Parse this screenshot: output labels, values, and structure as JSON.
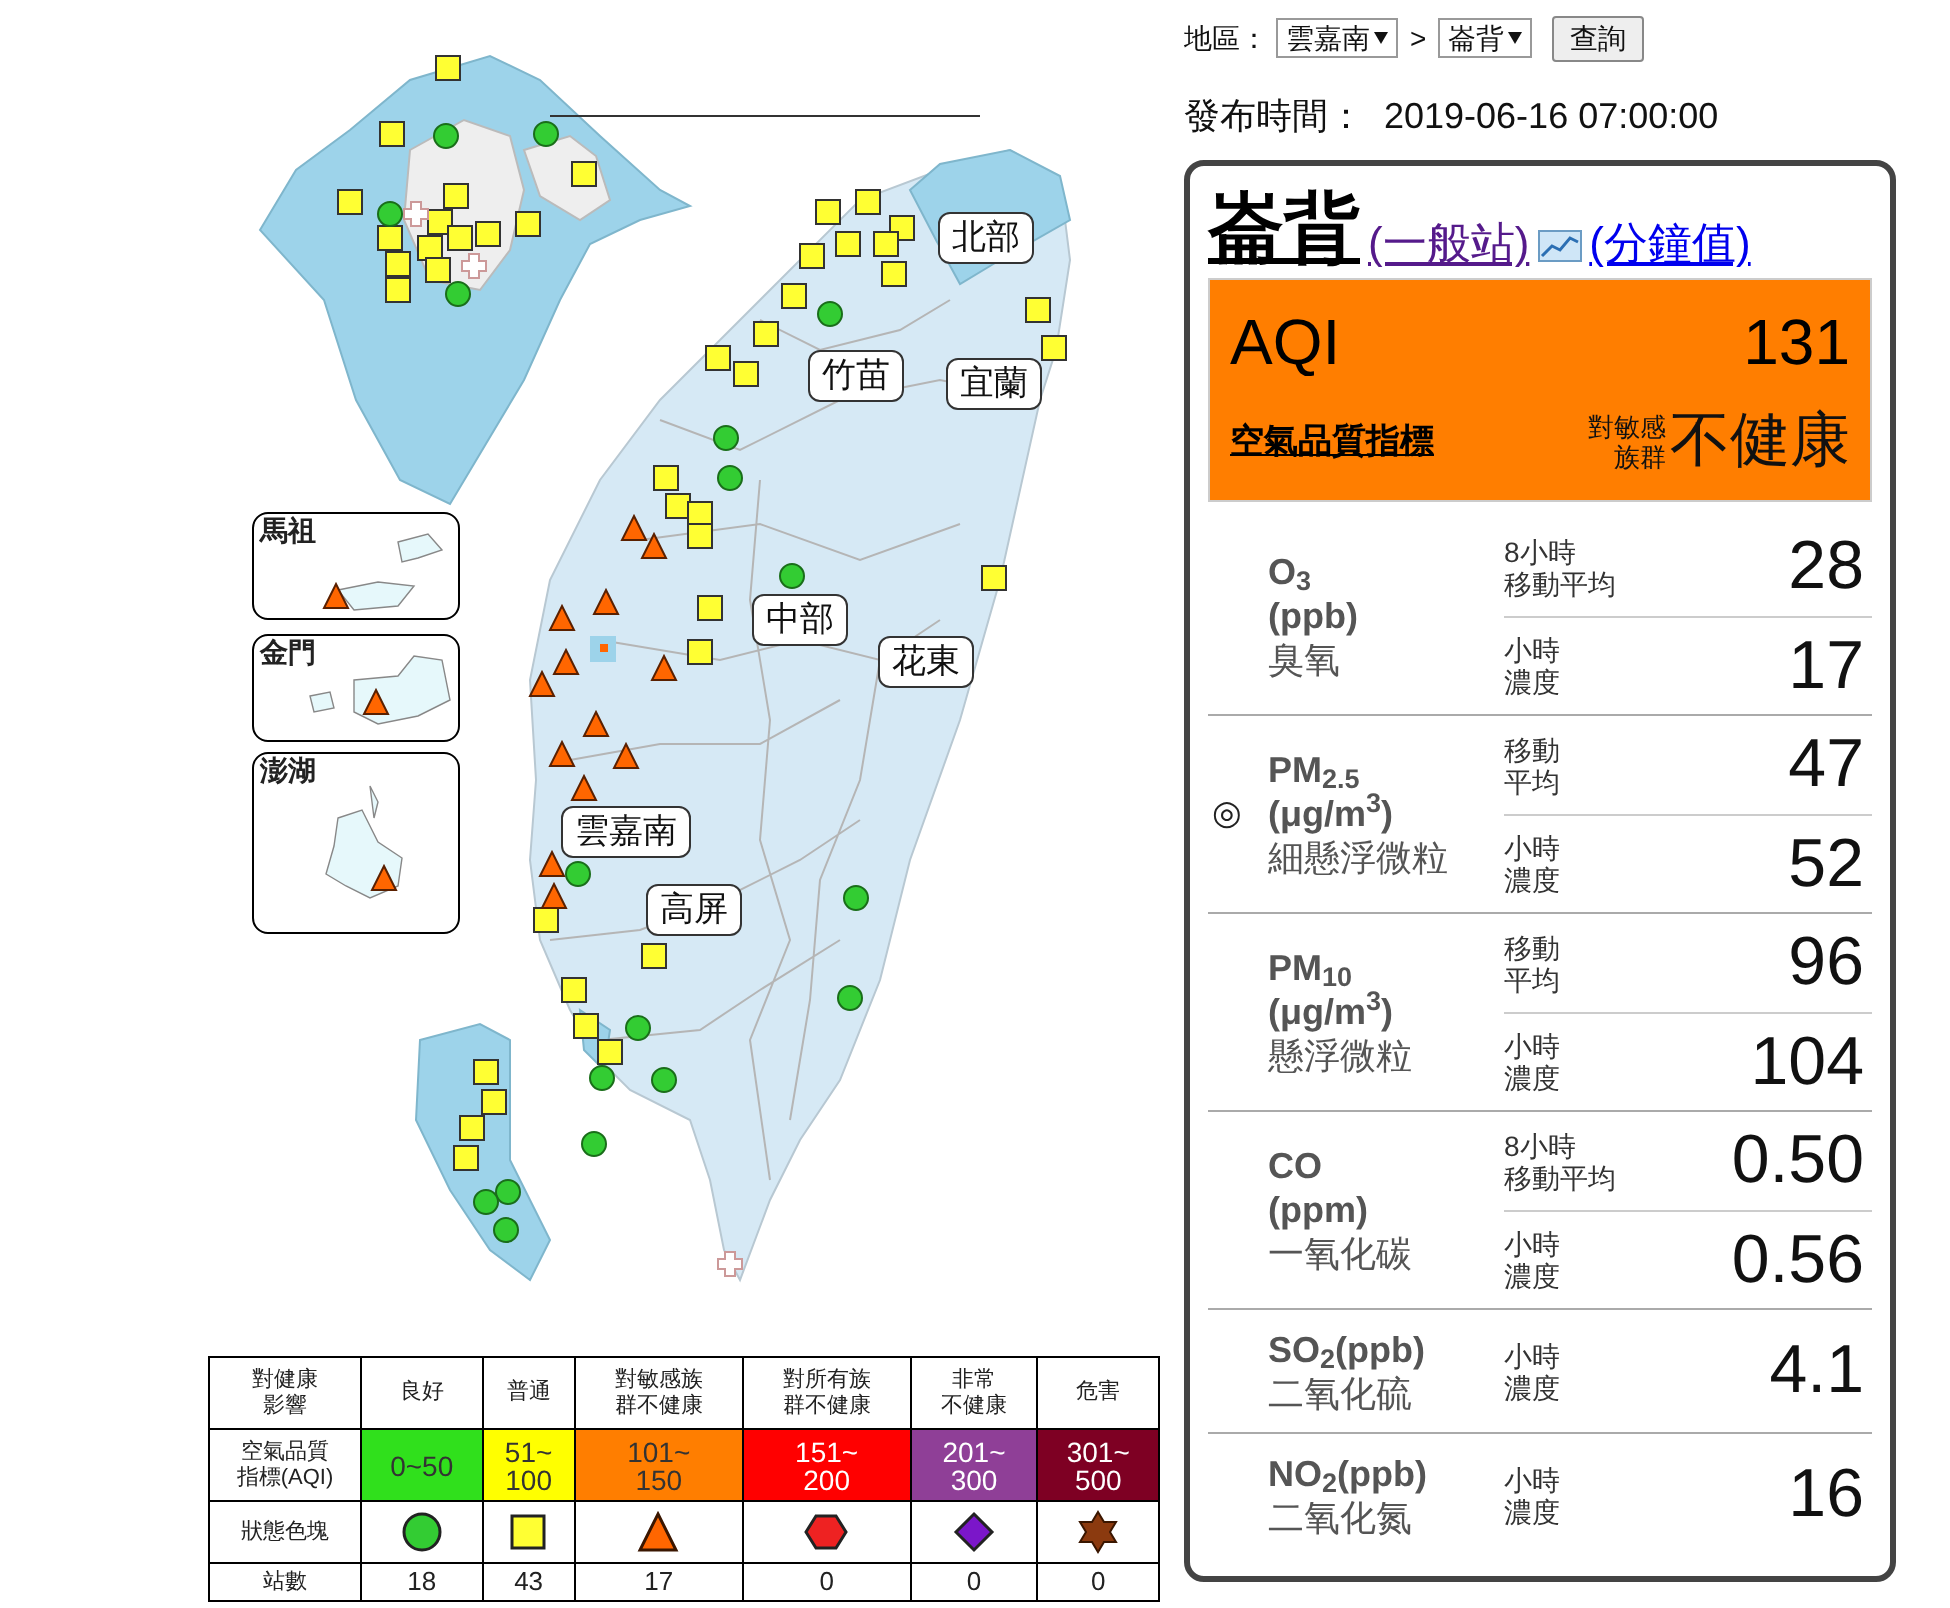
{
  "filter": {
    "label": "地區：",
    "region": "雲嘉南",
    "separator": ">",
    "station": "崙背",
    "button": "查詢"
  },
  "publish": {
    "label": "發布時間：",
    "time": "2019-06-16 07:00:00"
  },
  "station": {
    "name": "崙背",
    "type": "(一般站)",
    "minute_link": "(分鐘值)"
  },
  "aqi": {
    "label": "AQI",
    "value": "131",
    "link": "空氣品質指標",
    "group": [
      "對敏感",
      "族群"
    ],
    "status": "不健康",
    "color": "#ff7e00"
  },
  "primary_symbol": "◎",
  "pollutants": [
    {
      "name": "O$_{3}$",
      "unit": "(ppb)",
      "label": "臭氧",
      "primary": false,
      "readings": [
        {
          "label": [
            "8小時",
            "移動平均"
          ],
          "value": "28"
        },
        {
          "label": [
            "小時",
            "濃度"
          ],
          "value": "17"
        }
      ]
    },
    {
      "name": "PM$_{2.5}$",
      "unit": "(μg/m$^{3}$)",
      "label": "細懸浮微粒",
      "primary": true,
      "readings": [
        {
          "label": [
            "移動",
            "平均"
          ],
          "value": "47"
        },
        {
          "label": [
            "小時",
            "濃度"
          ],
          "value": "52"
        }
      ]
    },
    {
      "name": "PM$_{10}$",
      "unit": "(μg/m$^{3}$)",
      "label": "懸浮微粒",
      "primary": false,
      "readings": [
        {
          "label": [
            "移動",
            "平均"
          ],
          "value": "96"
        },
        {
          "label": [
            "小時",
            "濃度"
          ],
          "value": "104"
        }
      ]
    },
    {
      "name": "CO",
      "unit": "(ppm)",
      "label": "一氧化碳",
      "primary": false,
      "readings": [
        {
          "label": [
            "8小時",
            "移動平均"
          ],
          "value": "0.50"
        },
        {
          "label": [
            "小時",
            "濃度"
          ],
          "value": "0.56"
        }
      ]
    },
    {
      "name": "SO$_{2}$(ppb)",
      "label": "二氧化硫",
      "primary": false,
      "readings": [
        {
          "label": [
            "小時",
            "濃度"
          ],
          "value": "4.1"
        }
      ]
    },
    {
      "name": "NO$_{2}$(ppb)",
      "label": "二氧化氮",
      "primary": false,
      "readings": [
        {
          "label": [
            "小時",
            "濃度"
          ],
          "value": "16"
        }
      ]
    }
  ],
  "regions": [
    {
      "name": "北部"
    },
    {
      "name": "竹苗"
    },
    {
      "name": "宜蘭"
    },
    {
      "name": "中部"
    },
    {
      "name": "花東"
    },
    {
      "name": "雲嘉南"
    },
    {
      "name": "高屏"
    }
  ],
  "insets": [
    {
      "name": "馬祖"
    },
    {
      "name": "金門"
    },
    {
      "name": "澎湖"
    }
  ],
  "stations": [
    {
      "kind": "moderate"
    },
    {
      "kind": "moderate"
    },
    {
      "kind": "moderate"
    },
    {
      "kind": "moderate"
    },
    {
      "kind": "moderate"
    },
    {
      "kind": "moderate"
    },
    {
      "kind": "moderate"
    },
    {
      "kind": "moderate"
    },
    {
      "kind": "moderate"
    },
    {
      "kind": "moderate"
    },
    {
      "kind": "moderate"
    },
    {
      "kind": "moderate"
    },
    {
      "kind": "moderate"
    },
    {
      "kind": "moderate"
    },
    {
      "kind": "good"
    },
    {
      "kind": "good"
    },
    {
      "kind": "good"
    },
    {
      "kind": "good"
    },
    {
      "kind": "offline"
    },
    {
      "kind": "offline"
    },
    {
      "kind": "moderate"
    },
    {
      "kind": "moderate"
    },
    {
      "kind": "moderate"
    },
    {
      "kind": "moderate"
    },
    {
      "kind": "moderate"
    },
    {
      "kind": "moderate"
    },
    {
      "kind": "moderate"
    },
    {
      "kind": "moderate"
    },
    {
      "kind": "moderate"
    },
    {
      "kind": "moderate"
    },
    {
      "kind": "moderate"
    },
    {
      "kind": "moderate"
    },
    {
      "kind": "moderate"
    },
    {
      "kind": "moderate"
    },
    {
      "kind": "moderate"
    },
    {
      "kind": "moderate"
    },
    {
      "kind": "moderate"
    },
    {
      "kind": "moderate"
    },
    {
      "kind": "moderate"
    },
    {
      "kind": "moderate"
    },
    {
      "kind": "moderate"
    },
    {
      "kind": "good"
    },
    {
      "kind": "good"
    },
    {
      "kind": "good"
    },
    {
      "kind": "good"
    },
    {
      "kind": "good"
    },
    {
      "kind": "good"
    },
    {
      "kind": "sensitive"
    },
    {
      "kind": "sensitive"
    },
    {
      "kind": "sensitive"
    },
    {
      "kind": "sensitive"
    },
    {
      "kind": "sensitive"
    },
    {
      "kind": "sensitive"
    },
    {
      "kind": "sensitive"
    },
    {
      "kind": "sensitive"
    },
    {
      "kind": "sensitive"
    },
    {
      "kind": "sensitive"
    },
    {
      "kind": "sensitive"
    },
    {
      "kind": "sensitive"
    },
    {
      "kind": "sensitive"
    },
    {
      "kind": "sensitive"
    },
    {
      "kind": "sensitive"
    },
    {
      "kind": "sensitive"
    },
    {
      "kind": "moderate"
    },
    {
      "kind": "moderate"
    },
    {
      "kind": "moderate"
    },
    {
      "kind": "moderate"
    },
    {
      "kind": "moderate"
    },
    {
      "kind": "moderate"
    },
    {
      "kind": "moderate"
    },
    {
      "kind": "moderate"
    },
    {
      "kind": "good"
    },
    {
      "kind": "good"
    },
    {
      "kind": "good"
    },
    {
      "kind": "good"
    },
    {
      "kind": "good"
    },
    {
      "kind": "good"
    },
    {
      "kind": "good"
    },
    {
      "kind": "good"
    },
    {
      "kind": "offline"
    }
  ],
  "legend": {
    "row_labels": [
      [
        "對健康",
        "影響"
      ],
      [
        "空氣品質",
        "指標(AQI)"
      ],
      [
        "狀態色塊"
      ],
      [
        "站數"
      ]
    ],
    "levels": [
      {
        "label": [
          "良好"
        ],
        "range": [
          "0~50"
        ],
        "color": "#30e01c",
        "kind": "circle",
        "count": "18"
      },
      {
        "label": [
          "普通"
        ],
        "range": [
          "51~",
          "100"
        ],
        "color": "#ffff00",
        "kind": "square",
        "count": "43"
      },
      {
        "label": [
          "對敏感族",
          "群不健康"
        ],
        "range": [
          "101~",
          "150"
        ],
        "color": "#ff7e00",
        "kind": "triangle",
        "count": "17"
      },
      {
        "label": [
          "對所有族",
          "群不健康"
        ],
        "range": [
          "151~",
          "200"
        ],
        "color": "#ff0000",
        "kind": "hexagon",
        "count": "0"
      },
      {
        "label": [
          "非常",
          "不健康"
        ],
        "range": [
          "201~",
          "300"
        ],
        "color": "#8f3f97",
        "kind": "diamond",
        "count": "0"
      },
      {
        "label": [
          "危害"
        ],
        "range": [
          "301~",
          "500"
        ],
        "color": "#7e0023",
        "kind": "star",
        "count": "0"
      }
    ]
  }
}
